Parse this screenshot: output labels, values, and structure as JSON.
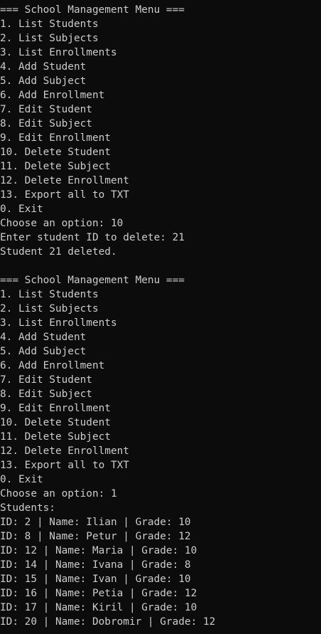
{
  "colors": {
    "background": "#0c0c0c",
    "foreground": "#cccccc"
  },
  "console": {
    "lines": [
      "=== School Management Menu ===",
      "1. List Students",
      "2. List Subjects",
      "3. List Enrollments",
      "4. Add Student",
      "5. Add Subject",
      "6. Add Enrollment",
      "7. Edit Student",
      "8. Edit Subject",
      "9. Edit Enrollment",
      "10. Delete Student",
      "11. Delete Subject",
      "12. Delete Enrollment",
      "13. Export all to TXT",
      "0. Exit",
      "Choose an option: 10",
      "Enter student ID to delete: 21",
      "Student 21 deleted.",
      "",
      "=== School Management Menu ===",
      "1. List Students",
      "2. List Subjects",
      "3. List Enrollments",
      "4. Add Student",
      "5. Add Subject",
      "6. Add Enrollment",
      "7. Edit Student",
      "8. Edit Subject",
      "9. Edit Enrollment",
      "10. Delete Student",
      "11. Delete Subject",
      "12. Delete Enrollment",
      "13. Export all to TXT",
      "0. Exit",
      "Choose an option: 1",
      "Students:",
      "ID: 2 | Name: Ilian | Grade: 10",
      "ID: 8 | Name: Petur | Grade: 12",
      "ID: 12 | Name: Maria | Grade: 10",
      "ID: 14 | Name: Ivana | Grade: 8",
      "ID: 15 | Name: Ivan | Grade: 10",
      "ID: 16 | Name: Petia | Grade: 12",
      "ID: 17 | Name: Kiril | Grade: 10",
      "ID: 20 | Name: Dobromir | Grade: 12"
    ]
  }
}
